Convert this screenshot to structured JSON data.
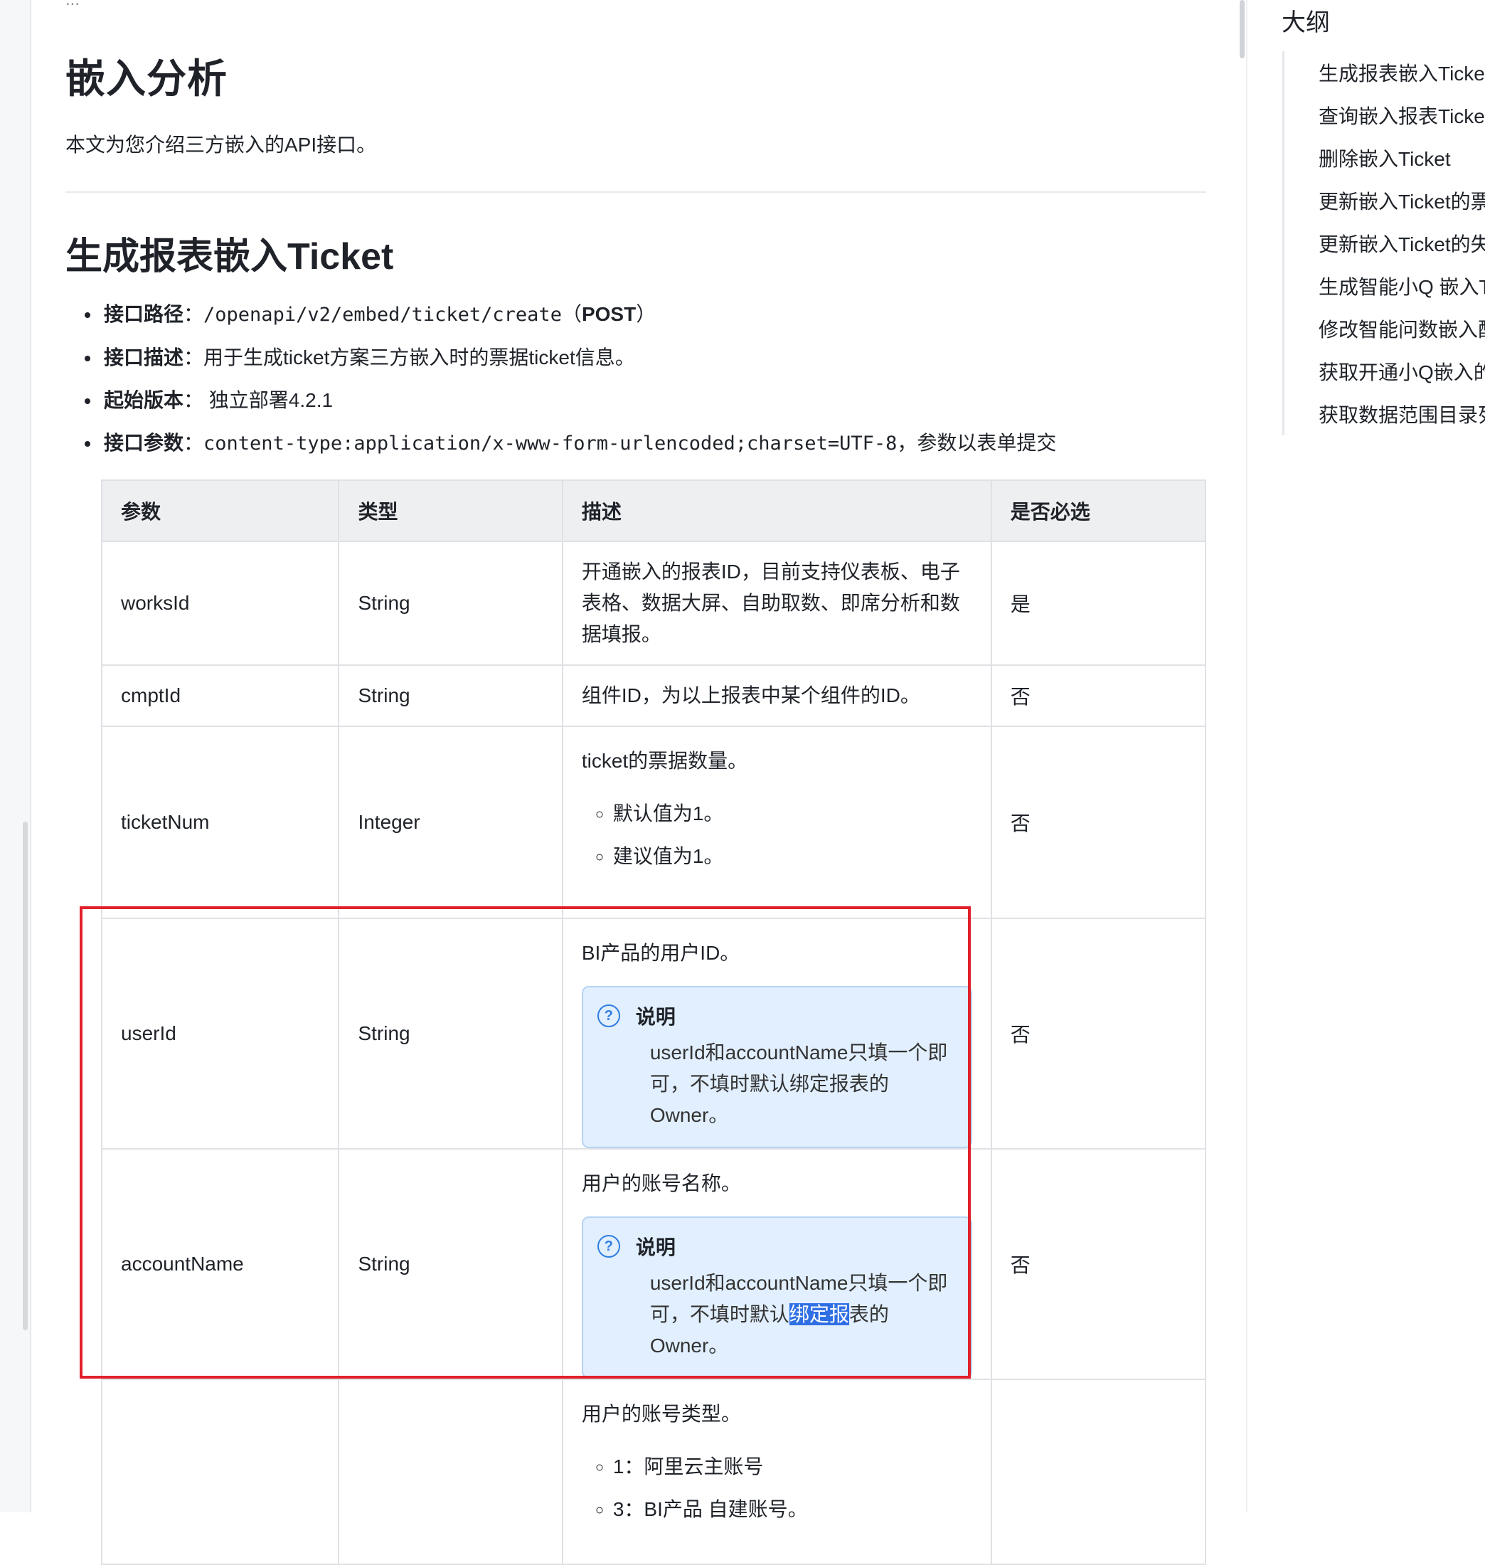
{
  "breadcrumb_cut": "...",
  "page": {
    "title": "嵌入分析",
    "intro": "本文为您介绍三方嵌入的API接口。"
  },
  "section": {
    "title": "生成报表嵌入Ticket",
    "items": [
      {
        "label": "接口路径",
        "sep": "：",
        "code": "/openapi/v2/embed/ticket/create",
        "suffix_open": "（",
        "suffix_bold": "POST",
        "suffix_close": "）"
      },
      {
        "label": "接口描述",
        "sep": "：",
        "text": "用于生成ticket方案三方嵌入时的票据ticket信息。"
      },
      {
        "label": "起始版本",
        "sep": "：",
        "text": " 独立部署4.2.1"
      },
      {
        "label": "接口参数",
        "sep": "：",
        "code": "content-type:application/x-www-form-urlencoded;charset=UTF-8",
        "text": "，参数以表单提交"
      }
    ]
  },
  "table": {
    "headers": [
      "参数",
      "类型",
      "描述",
      "是否必选"
    ],
    "rows": [
      {
        "param": "worksId",
        "type": "String",
        "desc": "开通嵌入的报表ID，目前支持仪表板、电子表格、数据大屏、自助取数、即席分析和数据填报。",
        "required": "是"
      },
      {
        "param": "cmptId",
        "type": "String",
        "desc": "组件ID，为以上报表中某个组件的ID。",
        "required": "否"
      },
      {
        "param": "ticketNum",
        "type": "Integer",
        "desc": "ticket的票据数量。",
        "bullets": [
          "默认值为1。",
          "建议值为1。"
        ],
        "required": "否"
      },
      {
        "param": "userId",
        "type": "String",
        "desc": "BI产品的用户ID。",
        "note_title": "说明",
        "note_text": "userId和accountName只填一个即可，不填时默认绑定报表的Owner。",
        "required": "否"
      },
      {
        "param": "accountName",
        "type": "String",
        "desc": "用户的账号名称。",
        "note_title": "说明",
        "note_text_pre": "userId和accountName只填一个即可，不填时默认",
        "note_text_sel": "绑定报",
        "note_text_post": "表的Owner。",
        "required": "否"
      },
      {
        "param": "",
        "type": "",
        "desc": "用户的账号类型。",
        "bullets": [
          "1：阿里云主账号",
          "3：BI产品 自建账号。"
        ],
        "required": ""
      }
    ]
  },
  "outline": {
    "title": "大纲",
    "items": [
      "生成报表嵌入Ticket",
      "查询嵌入报表Ticket",
      "删除嵌入Ticket",
      "更新嵌入Ticket的票",
      "更新嵌入Ticket的失",
      "生成智能小Q 嵌入T",
      "修改智能问数嵌入配",
      "获取开通小Q嵌入的",
      "获取数据范围目录列"
    ]
  },
  "colors": {
    "highlight_box": "#e0202a",
    "note_bg": "#e1efff",
    "note_icon": "#2f7de1",
    "selection": "#2f6fe3"
  }
}
